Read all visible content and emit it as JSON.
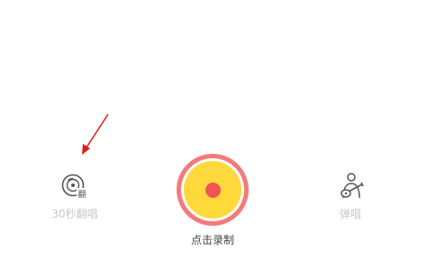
{
  "tools": {
    "cover": {
      "label": "30秒翻唱",
      "icon": "disc-cover-icon",
      "badge": "翻"
    },
    "play_sing": {
      "label": "弹唱",
      "icon": "guitar-singer-icon"
    }
  },
  "record": {
    "label": "点击录制",
    "icon": "record-dot-icon"
  },
  "annotation": {
    "icon": "red-arrow-icon",
    "color": "#e31b1b"
  },
  "colors": {
    "record_outer": "#f47a7a",
    "record_inner": "#ffd93b",
    "record_dot": "#f25454",
    "tool_label": "#c8c8c8"
  }
}
